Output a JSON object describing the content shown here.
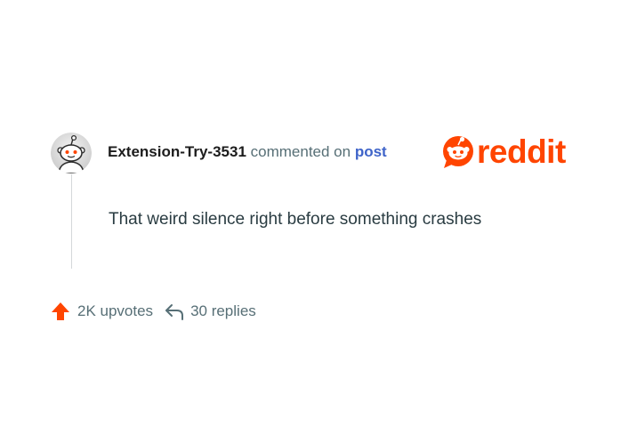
{
  "comment": {
    "username": "Extension-Try-3531",
    "action_text": "commented on",
    "post_link_label": "post",
    "body": "That weird silence right before something crashes",
    "avatar_icon": "snoo-avatar-icon"
  },
  "brand": {
    "logo_text": "reddit",
    "logo_icon": "snoo-icon",
    "accent_color": "#ff4500"
  },
  "footer": {
    "upvotes_label": "2K upvotes",
    "replies_label": "30 replies",
    "upvote_icon": "upvote-arrow-icon",
    "reply_icon": "reply-arrow-icon"
  },
  "colors": {
    "username": "#1c1c1c",
    "meta_text": "#576f76",
    "link": "#3f64c9",
    "body_text": "#2a3c42",
    "thread_line": "#d4d7da"
  }
}
